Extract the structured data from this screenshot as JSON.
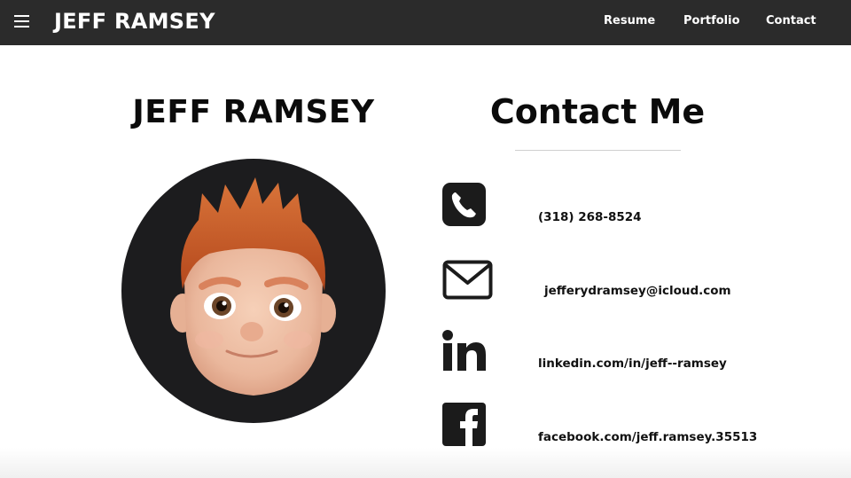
{
  "header": {
    "menu_icon": "hamburger-menu-icon",
    "brand": "JEFF RAMSEY",
    "nav": [
      {
        "label": "Resume"
      },
      {
        "label": "Portfolio"
      },
      {
        "label": "Contact"
      }
    ],
    "background_color": "#2b2b2b"
  },
  "profile": {
    "name": "JEFF RAMSEY",
    "avatar": "memoji-avatar"
  },
  "contact": {
    "title": "Contact Me",
    "items": [
      {
        "icon": "phone-icon",
        "text": "(318) 268-8524"
      },
      {
        "icon": "envelope-icon",
        "text": "jefferydramsey@icloud.com"
      },
      {
        "icon": "linkedin-icon",
        "text": "linkedin.com/in/jeff--ramsey"
      },
      {
        "icon": "facebook-icon",
        "text": "facebook.com/jeff.ramsey.35513"
      }
    ]
  }
}
